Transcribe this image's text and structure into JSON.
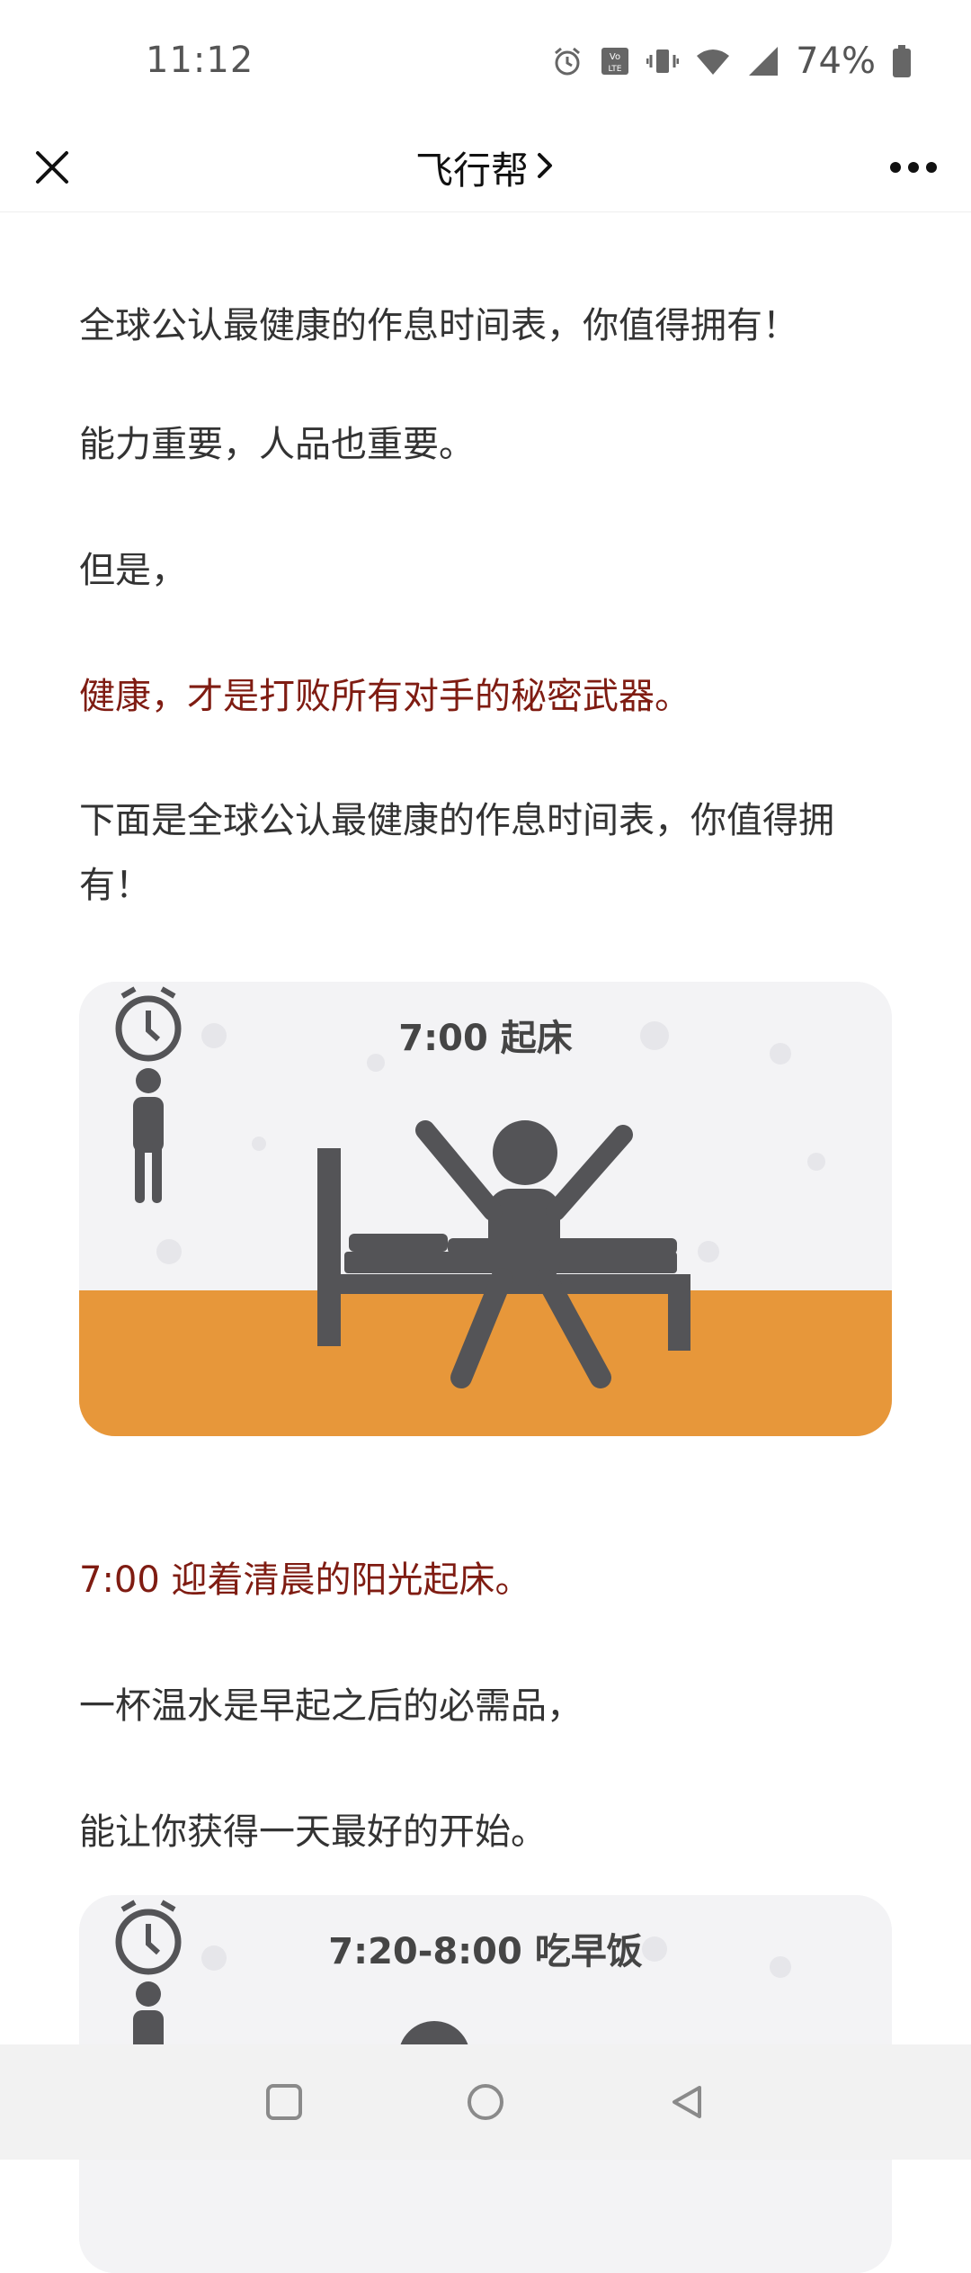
{
  "status_bar": {
    "time": "11:12",
    "battery": "74%",
    "icons": [
      "alarm-icon",
      "volte-icon",
      "vibrate-icon",
      "wifi-icon",
      "signal-icon",
      "battery-icon"
    ]
  },
  "nav": {
    "title": "飞行帮",
    "chevron": "›"
  },
  "article": {
    "p1": "全球公认最健康的作息时间表，你值得拥有！",
    "p2": "能力重要，人品也重要。",
    "p3": "但是，",
    "p4": "健康，才是打败所有对手的秘密武器。",
    "p5": "下面是全球公认最健康的作息时间表，你值得拥有！",
    "image1_title": "7:00 起床",
    "p6": "7:00 迎着清晨的阳光起床。",
    "p7": "一杯温水是早起之后的必需品，",
    "p8": "能让你获得一天最好的开始。",
    "image2_title": "7:20-8:00 吃早饭"
  },
  "colors": {
    "accent_text": "#7f1c12",
    "illustration_orange": "#e7973a",
    "illustration_figure": "#545457"
  }
}
